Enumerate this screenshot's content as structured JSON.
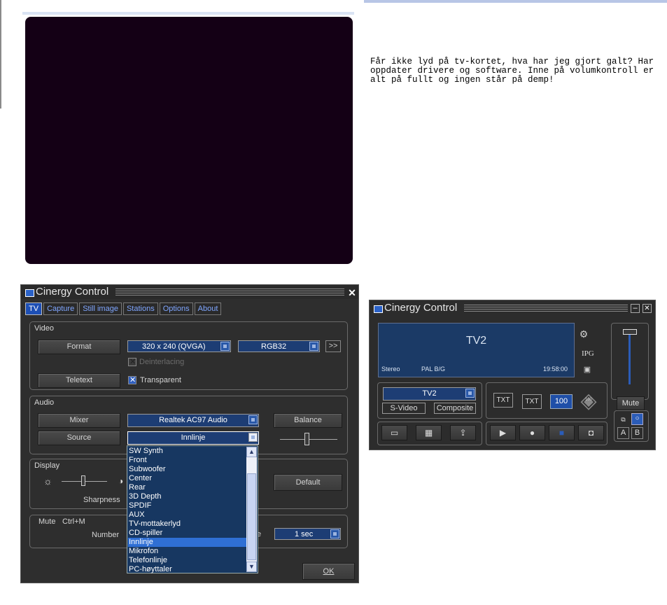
{
  "forum": {
    "text": "Får ikke lyd på tv-kortet, hva har jeg gjort galt? Har oppdater drivere og software. Inne på volumkontroll er alt på fullt og ingen står på demp!"
  },
  "dialog": {
    "title": "Cinergy Control",
    "close": "✕",
    "tabs": [
      "TV",
      "Capture",
      "Still image",
      "Stations",
      "Options",
      "About"
    ],
    "video": {
      "label": "Video",
      "format_btn": "Format",
      "format_value": "320 x 240 (QVGA)",
      "color_value": "RGB32",
      "more": ">>",
      "deinterlacing": "Deinterlacing",
      "teletext_btn": "Teletext",
      "transparent": "Transparent"
    },
    "audio": {
      "label": "Audio",
      "mixer_btn": "Mixer",
      "mixer_value": "Realtek AC97 Audio",
      "balance_btn": "Balance",
      "source_btn": "Source",
      "source_value": "Innlinje"
    },
    "display": {
      "label": "Display",
      "sharpness": "Sharpness",
      "default_btn": "Default"
    },
    "osd": {
      "mute": "Mute",
      "shortcut": "Ctrl+M",
      "number": "Number",
      "duration": "1 sec"
    },
    "ok": "OK",
    "dropdown": {
      "items": [
        "SW Synth",
        "Front",
        "Subwoofer",
        "Center",
        "Rear",
        "3D Depth",
        "SPDIF",
        "AUX",
        "TV-mottakerlyd",
        "CD-spiller",
        "Innlinje",
        "Mikrofon",
        "Telefonlinje",
        "PC-høyttaler"
      ],
      "selected_index": 10
    }
  },
  "player": {
    "title": "Cinergy Control",
    "channel": "TV2",
    "audio_mode": "Stereo",
    "tv_standard": "PAL B/G",
    "time": "19:58:00",
    "ipg": "IPG",
    "channel_select": "TV2",
    "svideo_btn": "S-Video",
    "composite_btn": "Composite",
    "txt1": "TXT",
    "txt2": "TXT",
    "page": "100",
    "dpad_center": "100",
    "mute_btn": "Mute",
    "a_btn": "A",
    "b_btn": "B"
  }
}
